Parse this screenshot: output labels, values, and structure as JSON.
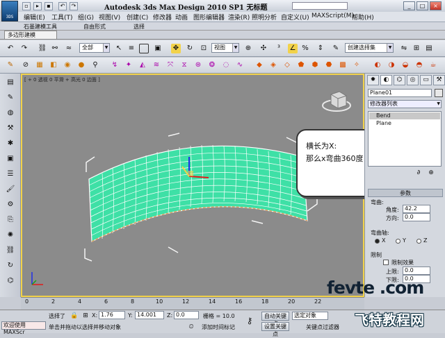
{
  "title_bar": {
    "title": "Autodesk 3ds Max Design 2010 SP1    无标题",
    "logo_text": "3DS"
  },
  "menu": [
    "编辑(E)",
    "工具(T)",
    "组(G)",
    "视图(V)",
    "创建(C)",
    "修改器",
    "动画",
    "图形编辑器",
    "渲染(R)",
    "照明分析",
    "自定义(U)",
    "MAXScript(M)",
    "帮助(H)"
  ],
  "ribbon": {
    "tabs": [
      "石墨建模工具",
      "自由形式",
      "选择"
    ],
    "subtab": "多边形建模"
  },
  "main_toolbar": {
    "selection_filter": "全部",
    "ref_coord": "视图",
    "named_selection": "创建选择集"
  },
  "viewport": {
    "label": "[ + 0 透视 0 平滑 + 高光 0 边面 ]",
    "highlight_color": "#f2d24a",
    "mesh_color": "#3ee0a6"
  },
  "callout": {
    "line1": "横长为X:",
    "line2": "那么x弯曲360度"
  },
  "command_panel": {
    "object_name": "Plane01",
    "modifier_list": "修改器列表",
    "stack": [
      "Bend",
      "Plane"
    ],
    "rollout_title": "参数",
    "bend_section": "弯曲:",
    "angle_label": "角度:",
    "angle_value": "42.2",
    "direction_label": "方向:",
    "direction_value": "0.0",
    "axis_section": "弯曲轴:",
    "axis_x": "X",
    "axis_y": "Y",
    "axis_z": "Z",
    "limit_section": "限制",
    "limit_effect": "限制效果",
    "upper_label": "上限:",
    "upper_value": "0.0",
    "lower_label": "下限:",
    "lower_value": "0.0"
  },
  "timeline": {
    "ticks": [
      "0",
      "2",
      "4",
      "6",
      "8",
      "10",
      "12",
      "14",
      "16",
      "18",
      "20",
      "22"
    ]
  },
  "status": {
    "welcome": "欢迎使用 MAXScr",
    "selected": "选择了",
    "prompt": "单击并拖动以选择并移动对象",
    "x_label": "X:",
    "x_value": "1.76",
    "y_label": "Y:",
    "y_value": "14.001",
    "z_label": "Z:",
    "z_value": "0.0",
    "grid": "栅格 = 10.0",
    "add_time_tag": "添加时间标记",
    "auto_key": "自动关键点",
    "set_key": "设置关键点",
    "selected_obj": "选定对象",
    "key_filter": "关键点过滤器"
  },
  "watermark": {
    "site": "fevte .com",
    "name": "飞特教程网"
  }
}
